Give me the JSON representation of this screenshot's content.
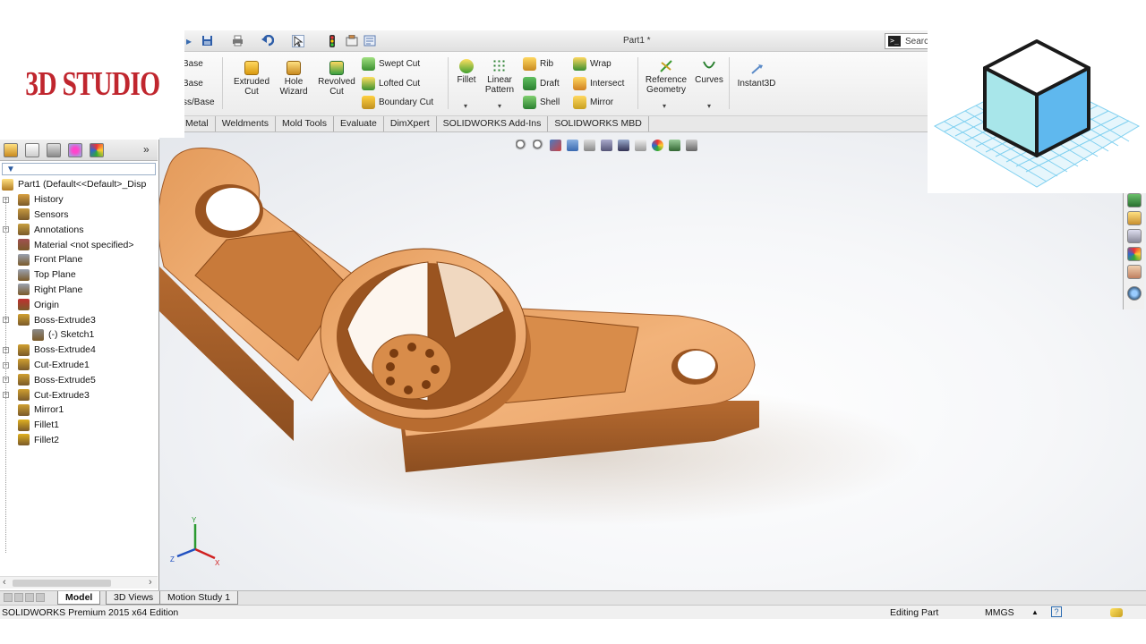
{
  "logo": {
    "text": "3D STUDIO"
  },
  "title_bar": {
    "document_title": "Part1 *",
    "search_placeholder": "Searc",
    "quick_access_icons": [
      "options-icon",
      "save-icon",
      "print-icon",
      "undo-icon",
      "select-icon",
      "rebuild-icon",
      "file-properties-icon",
      "options-settings-icon"
    ]
  },
  "ribbon": {
    "boss_base_items": [
      "Base",
      "Base",
      "ss/Base"
    ],
    "extruded_cut": "Extruded\nCut",
    "hole_wizard": "Hole\nWizard",
    "revolved_cut": "Revolved\nCut",
    "swept_cut": "Swept Cut",
    "lofted_cut": "Lofted Cut",
    "boundary_cut": "Boundary Cut",
    "fillet": "Fillet",
    "linear_pattern": "Linear\nPattern",
    "rib": "Rib",
    "draft": "Draft",
    "shell": "Shell",
    "wrap": "Wrap",
    "intersect": "Intersect",
    "mirror": "Mirror",
    "reference_geometry": "Reference\nGeometry",
    "curves": "Curves",
    "instant3d": "Instant3D"
  },
  "tabs": [
    "Metal",
    "Weldments",
    "Mold Tools",
    "Evaluate",
    "DimXpert",
    "SOLIDWORKS Add-Ins",
    "SOLIDWORKS MBD"
  ],
  "feature_tree": {
    "root": "Part1  (Default<<Default>_Disp",
    "items": [
      {
        "label": "History",
        "expandable": true,
        "color": "#d8a040"
      },
      {
        "label": "Sensors",
        "expandable": false,
        "color": "#c89a40"
      },
      {
        "label": "Annotations",
        "expandable": true,
        "color": "#c8a040"
      },
      {
        "label": "Material <not specified>",
        "expandable": false,
        "color": "#a05050"
      },
      {
        "label": "Front Plane",
        "expandable": false,
        "color": "#9aa2b0"
      },
      {
        "label": "Top Plane",
        "expandable": false,
        "color": "#9aa2b0"
      },
      {
        "label": "Right Plane",
        "expandable": false,
        "color": "#9aa2b0"
      },
      {
        "label": "Origin",
        "expandable": false,
        "color": "#c03030"
      },
      {
        "label": "Boss-Extrude3",
        "expandable": true,
        "color": "#d0a030"
      },
      {
        "label": "(-) Sketch1",
        "expandable": false,
        "color": "#8a8a8a",
        "indent": true
      },
      {
        "label": "Boss-Extrude4",
        "expandable": true,
        "color": "#d0a030"
      },
      {
        "label": "Cut-Extrude1",
        "expandable": true,
        "color": "#d0a030"
      },
      {
        "label": "Boss-Extrude5",
        "expandable": true,
        "color": "#d0a030"
      },
      {
        "label": "Cut-Extrude3",
        "expandable": true,
        "color": "#d0a030"
      },
      {
        "label": "Mirror1",
        "expandable": false,
        "color": "#d0a030"
      },
      {
        "label": "Fillet1",
        "expandable": false,
        "color": "#e0b020"
      },
      {
        "label": "Fillet2",
        "expandable": false,
        "color": "#e0b020"
      }
    ]
  },
  "bottom_tabs": [
    "Model",
    "3D Views",
    "Motion Study 1"
  ],
  "status_bar": {
    "edition": "SOLIDWORKS Premium 2015 x64 Edition",
    "mode": "Editing Part",
    "units": "MMGS",
    "units_caret": "▲"
  },
  "triad": {
    "x": "X",
    "y": "Y",
    "z": "Z"
  },
  "colors": {
    "part_color": "#d9874a",
    "logo_red": "#c0262e"
  }
}
